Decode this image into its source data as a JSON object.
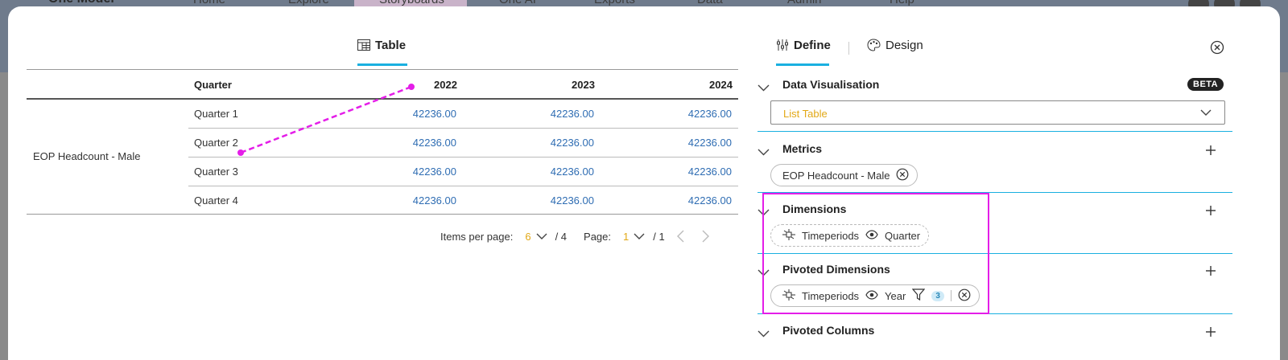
{
  "bg_nav": {
    "logo": "One Model",
    "items": [
      "Home",
      "Explore",
      "Storyboards",
      "One AI",
      "Exports",
      "Data",
      "Admin",
      "Help"
    ]
  },
  "left": {
    "tab_label": "Table",
    "table": {
      "header": {
        "dimension": "Quarter",
        "years": [
          "2022",
          "2023",
          "2024"
        ]
      },
      "metric_label": "EOP Headcount - Male",
      "rows": [
        {
          "quarter": "Quarter 1",
          "values": [
            "42236.00",
            "42236.00",
            "42236.00"
          ]
        },
        {
          "quarter": "Quarter 2",
          "values": [
            "42236.00",
            "42236.00",
            "42236.00"
          ]
        },
        {
          "quarter": "Quarter 3",
          "values": [
            "42236.00",
            "42236.00",
            "42236.00"
          ]
        },
        {
          "quarter": "Quarter 4",
          "values": [
            "42236.00",
            "42236.00",
            "42236.00"
          ]
        }
      ]
    },
    "pager": {
      "items_label": "Items per page:",
      "items_value": "6",
      "items_total": "/ 4",
      "page_label": "Page:",
      "page_value": "1",
      "page_total": "/ 1"
    }
  },
  "right": {
    "tabs": {
      "define": "Define",
      "design": "Design"
    },
    "sections": {
      "data_vis": {
        "title": "Data Visualisation",
        "badge": "BETA",
        "select_value": "List Table"
      },
      "metrics": {
        "title": "Metrics",
        "pill": "EOP Headcount - Male"
      },
      "dimensions": {
        "title": "Dimensions",
        "pill_group": "Timeperiods",
        "pill_level": "Quarter"
      },
      "pivoted_dimensions": {
        "title": "Pivoted Dimensions",
        "pill_group": "Timeperiods",
        "pill_level": "Year",
        "filter_count": "3"
      },
      "pivoted_columns": {
        "title": "Pivoted Columns"
      }
    }
  },
  "colors": {
    "accent": "#1ab0e0",
    "value_blue": "#2f6db3",
    "highlight_yellow": "#e2a816",
    "annotation_magenta": "#e41ee8"
  }
}
